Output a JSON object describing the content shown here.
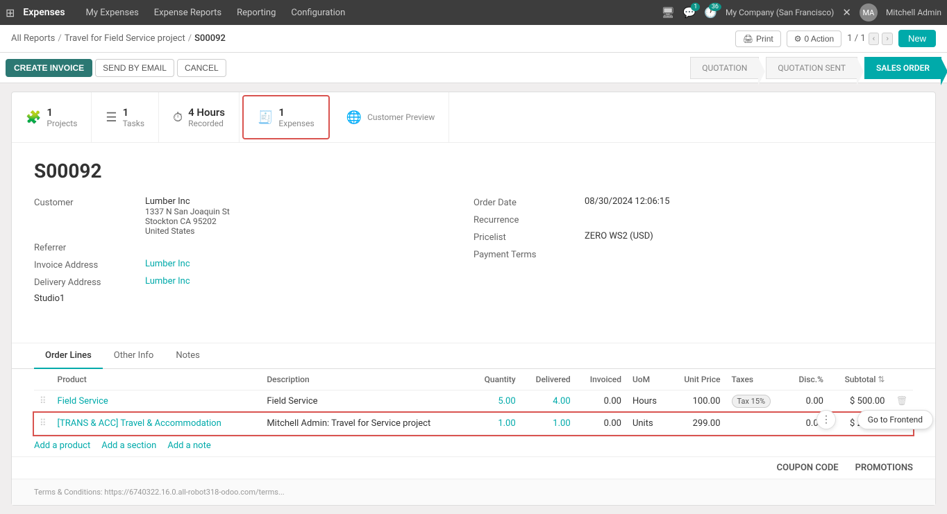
{
  "topNav": {
    "appName": "Expenses",
    "navLinks": [
      "My Expenses",
      "Expense Reports",
      "Reporting",
      "Configuration"
    ],
    "companyName": "My Company (San Francisco)",
    "userName": "Mitchell Admin",
    "notifCount": "1",
    "updateCount": "36"
  },
  "breadcrumb": {
    "parts": [
      "All Reports",
      "Travel for Field Service project",
      "S00092"
    ],
    "separators": [
      "/",
      "/"
    ]
  },
  "toolbar": {
    "printLabel": "Print",
    "actionLabel": "0 Action",
    "pagination": "1 / 1",
    "newLabel": "New"
  },
  "actionBar": {
    "createInvoiceLabel": "CREATE INVOICE",
    "sendEmailLabel": "SEND BY EMAIL",
    "cancelLabel": "CANCEL",
    "statusPills": [
      "QUOTATION",
      "QUOTATION SENT",
      "SALES ORDER"
    ]
  },
  "smartButtons": [
    {
      "icon": "puzzle",
      "count": "1",
      "label": "Projects"
    },
    {
      "icon": "list",
      "count": "1",
      "label": "Tasks"
    },
    {
      "icon": "clock",
      "count": "4 Hours",
      "label": "Recorded"
    },
    {
      "icon": "receipt",
      "count": "1",
      "label": "Expenses",
      "highlighted": true
    },
    {
      "icon": "globe",
      "count": "",
      "label": "Customer Preview"
    }
  ],
  "record": {
    "id": "S00092",
    "customerLabel": "Customer",
    "customerName": "Lumber Inc",
    "customerAddress1": "1337 N San Joaquin St",
    "customerAddress2": "Stockton CA 95202",
    "customerAddress3": "United States",
    "referrerLabel": "Referrer",
    "invoiceAddressLabel": "Invoice Address",
    "invoiceAddressValue": "Lumber Inc",
    "deliveryAddressLabel": "Delivery Address",
    "deliveryAddressValue": "Lumber Inc",
    "studioLabel": "Studio1",
    "orderDateLabel": "Order Date",
    "orderDateValue": "08/30/2024 12:06:15",
    "recurrenceLabel": "Recurrence",
    "pricelistLabel": "Pricelist",
    "pricelistValue": "ZERO WS2 (USD)",
    "paymentTermsLabel": "Payment Terms"
  },
  "tabs": [
    "Order Lines",
    "Other Info",
    "Notes"
  ],
  "activeTab": "Order Lines",
  "tableHeaders": [
    "Product",
    "Description",
    "Quantity",
    "Delivered",
    "Invoiced",
    "UoM",
    "Unit Price",
    "Taxes",
    "Disc.%",
    "Subtotal"
  ],
  "tableRows": [
    {
      "product": "Field Service",
      "description": "Field Service",
      "quantity": "5.00",
      "delivered": "4.00",
      "invoiced": "0.00",
      "uom": "Hours",
      "unitPrice": "100.00",
      "taxes": "Tax 15%",
      "disc": "0.00",
      "subtotal": "$ 500.00",
      "highlighted": false
    },
    {
      "product": "[TRANS & ACC] Travel & Accommodation",
      "description": "Mitchell Admin: Travel for Service project",
      "quantity": "1.00",
      "delivered": "1.00",
      "invoiced": "0.00",
      "uom": "Units",
      "unitPrice": "299.00",
      "taxes": "",
      "disc": "0.00",
      "subtotal": "$ 299.00",
      "highlighted": true
    }
  ],
  "addLinks": [
    "Add a product",
    "Add a section",
    "Add a note"
  ],
  "couponBar": {
    "couponLabel": "COUPON CODE",
    "promotionsLabel": "PROMOTIONS"
  },
  "footer": {
    "termsText": "Terms & Conditions: https://6740322.16.0.all-robot318-odoo.com/terms..."
  },
  "floatingBtn": "Go to Frontend"
}
